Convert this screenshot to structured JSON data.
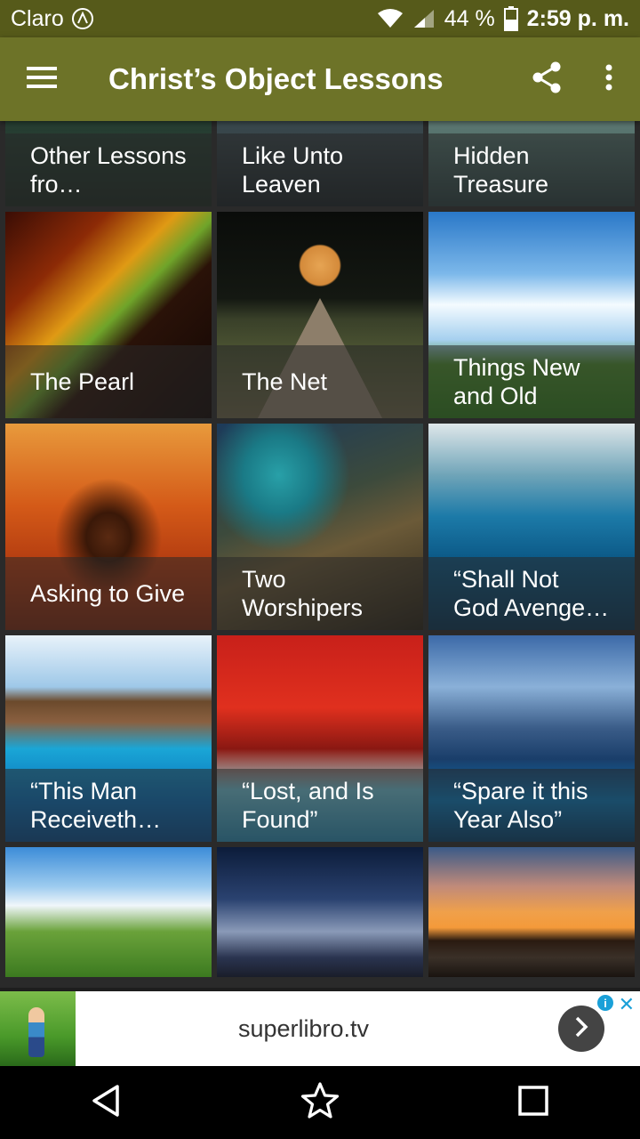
{
  "status_bar": {
    "carrier": "Claro",
    "battery": "44 %",
    "time": "2:59 p. m."
  },
  "app_bar": {
    "title": "Christ’s Object Lessons"
  },
  "lessons": [
    {
      "title": "Other Lessons fro…"
    },
    {
      "title": "Like Unto Leaven"
    },
    {
      "title": "Hidden Treasure"
    },
    {
      "title": "The Pearl"
    },
    {
      "title": "The Net"
    },
    {
      "title": "Things New and Old"
    },
    {
      "title": "Asking to Give"
    },
    {
      "title": "Two Worshipers"
    },
    {
      "title": "“Shall Not God Avenge His …"
    },
    {
      "title": "“This Man Receiveth Si…"
    },
    {
      "title": "“Lost, and Is Found”"
    },
    {
      "title": "“Spare it this Year Also”"
    }
  ],
  "ad": {
    "text": "superlibro.tv",
    "info_label": "i",
    "close_label": "✕"
  },
  "colors": {
    "status_bar": "#565a1a",
    "app_bar": "#6d7328",
    "ad_accent": "#1aa0d8"
  }
}
